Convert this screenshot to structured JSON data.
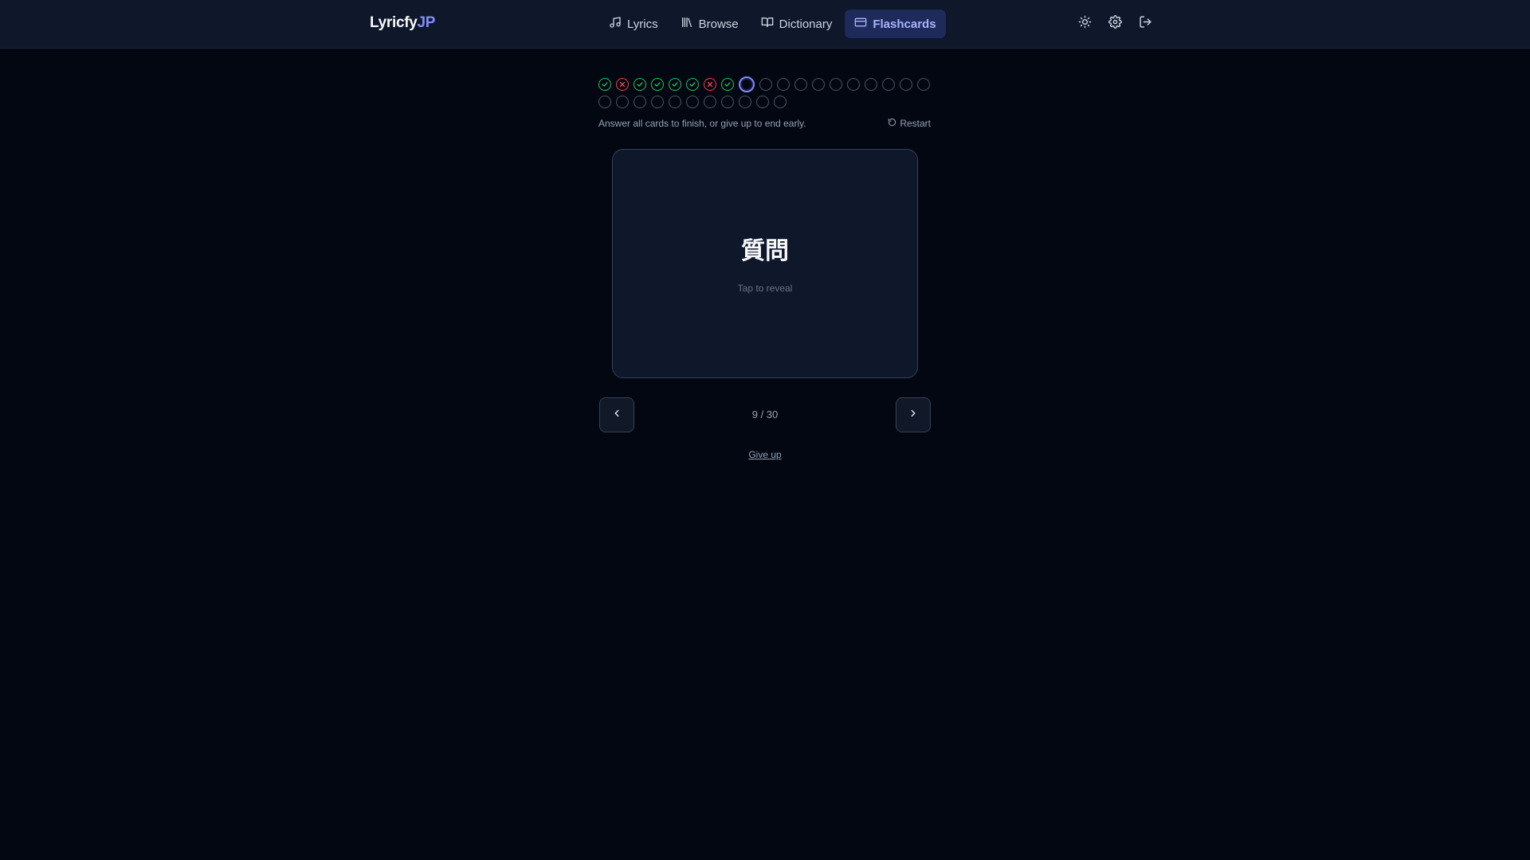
{
  "app": {
    "logo_main": "Lyricfy",
    "logo_accent": "JP"
  },
  "nav": {
    "items": [
      {
        "label": "Lyrics",
        "icon": "music-note-icon"
      },
      {
        "label": "Browse",
        "icon": "library-icon"
      },
      {
        "label": "Dictionary",
        "icon": "book-open-icon"
      },
      {
        "label": "Flashcards",
        "icon": "card-icon",
        "active": true
      }
    ]
  },
  "header_actions": [
    {
      "icon": "sun-icon"
    },
    {
      "icon": "gear-icon"
    },
    {
      "icon": "logout-icon"
    }
  ],
  "progress": {
    "total": 30,
    "current": 9,
    "statuses": [
      "correct",
      "wrong",
      "correct",
      "correct",
      "correct",
      "correct",
      "wrong",
      "correct",
      "current",
      "pending",
      "pending",
      "pending",
      "pending",
      "pending",
      "pending",
      "pending",
      "pending",
      "pending",
      "pending",
      "pending",
      "pending",
      "pending",
      "pending",
      "pending",
      "pending",
      "pending",
      "pending",
      "pending",
      "pending",
      "pending"
    ],
    "info_text": "Answer all cards to finish, or give up to end early.",
    "restart_label": "Restart"
  },
  "card": {
    "word": "質問",
    "hint": "Tap to reveal"
  },
  "pager": {
    "counter": "9 / 30"
  },
  "give_up_label": "Give up",
  "colors": {
    "background": "#030712",
    "header": "#0f172a",
    "accent": "#818cf8",
    "correct": "#22c55e",
    "wrong": "#ef4444"
  }
}
